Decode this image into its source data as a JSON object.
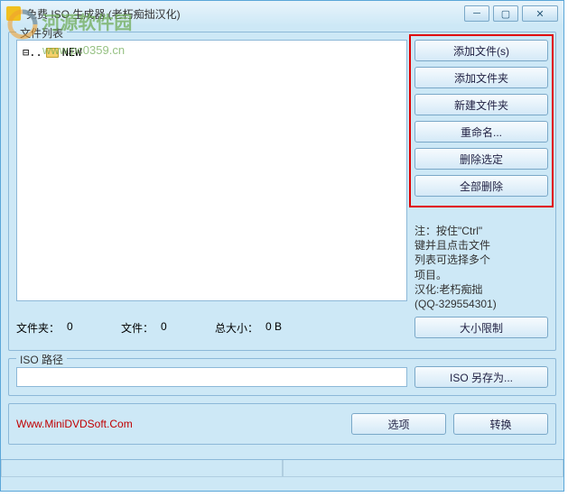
{
  "window": {
    "title": "免费 ISO 生成器 (老朽痴拙汉化)"
  },
  "watermark": {
    "text": "河源软件园",
    "url": "www.pc0359.cn"
  },
  "fileListLegend": "文件列表",
  "tree": {
    "root": "NEW"
  },
  "buttons": {
    "addFiles": "添加文件(s)",
    "addFolder": "添加文件夹",
    "newFolder": "新建文件夹",
    "rename": "重命名...",
    "deleteSelected": "删除选定",
    "deleteAll": "全部删除",
    "sizeLimit": "大小限制",
    "isoSaveAs": "ISO 另存为...",
    "options": "选项",
    "convert": "转换"
  },
  "hint": {
    "line1": "注：按住\"Ctrl\"",
    "line2": "键并且点击文件",
    "line3": "列表可选择多个",
    "line4": "项目。",
    "line5": "汉化:老朽痴拙",
    "line6": "(QQ-329554301)"
  },
  "stats": {
    "foldersLabel": "文件夹：",
    "foldersValue": "0",
    "filesLabel": "文件：",
    "filesValue": "0",
    "totalSizeLabel": "总大小：",
    "totalSizeValue": "0 B"
  },
  "isoPathLegend": "ISO 路径",
  "isoPathValue": "",
  "footer": {
    "url": "Www.MiniDVDSoft.Com"
  }
}
